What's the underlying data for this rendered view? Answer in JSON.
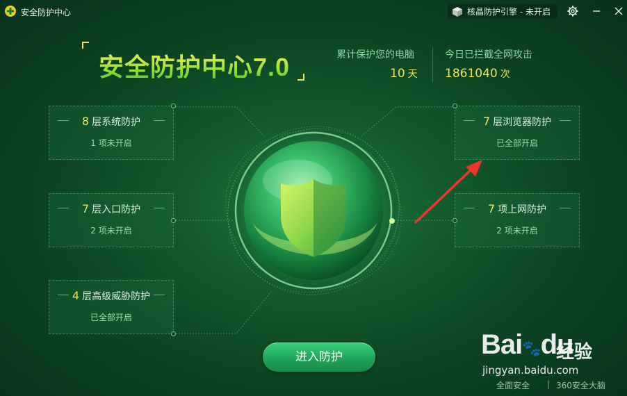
{
  "app": {
    "title": "安全防护中心",
    "engine_label": "核晶防护引擎 - 未开启"
  },
  "header": {
    "title": "安全防护中心7.0",
    "protected_label": "累计保护您的电脑",
    "protected_value": "10",
    "protected_unit": "天",
    "blocked_label": "今日已拦截全网攻击",
    "blocked_value": "1861040",
    "blocked_unit": "次"
  },
  "cards": {
    "system": {
      "num": "8",
      "title": "层系统防护",
      "status": "1 项未开启"
    },
    "entry": {
      "num": "7",
      "title": "层入口防护",
      "status": "2 项未开启"
    },
    "threat": {
      "num": "4",
      "title": "层高级威胁防护",
      "status": "已全部开启"
    },
    "browser": {
      "num": "7",
      "title": "层浏览器防护",
      "status": "已全部开启"
    },
    "internet": {
      "num": "7",
      "title": "项上网防护",
      "status": "2 项未开启"
    }
  },
  "actions": {
    "enter_label": "进入防护"
  },
  "watermark": {
    "logo": "Bai",
    "logo_tail": "du",
    "jingyan": "经验",
    "url": "jingyan.baidu.com"
  },
  "footer": {
    "left": "全面安全",
    "right": "360安全大脑"
  },
  "colors": {
    "accent_yellow": "#f4e35a",
    "button_green": "#1ea55a",
    "arrow_red": "#e8392b"
  }
}
